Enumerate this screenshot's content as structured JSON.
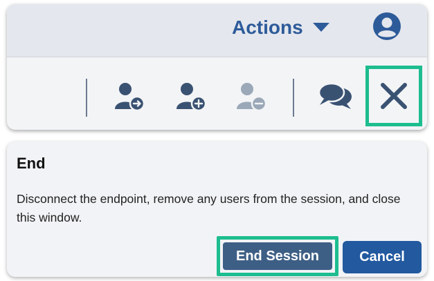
{
  "header": {
    "actions_label": "Actions",
    "actions_icon": "caret-down-icon",
    "avatar_icon": "user-circle-icon"
  },
  "toolbar": {
    "buttons": [
      {
        "name": "transfer-user-button",
        "icon": "user-arrow-icon",
        "enabled": true
      },
      {
        "name": "add-user-button",
        "icon": "user-plus-icon",
        "enabled": true
      },
      {
        "name": "remove-user-button",
        "icon": "user-minus-icon",
        "enabled": false
      },
      {
        "name": "chat-button",
        "icon": "chat-bubbles-icon",
        "enabled": true
      },
      {
        "name": "end-button",
        "icon": "close-icon",
        "enabled": true,
        "highlighted": true
      }
    ]
  },
  "popover": {
    "title": "End",
    "description": "Disconnect the endpoint, remove any users from the session, and close this window.",
    "end_session_label": "End Session",
    "cancel_label": "Cancel"
  },
  "colors": {
    "accent_blue": "#2d5b9a",
    "icon_dark": "#3a5272",
    "icon_disabled": "#9aa8b8",
    "highlight_green": "#1dbd8f",
    "end_button_bg": "#3e5f85",
    "cancel_button_bg": "#22599f"
  }
}
